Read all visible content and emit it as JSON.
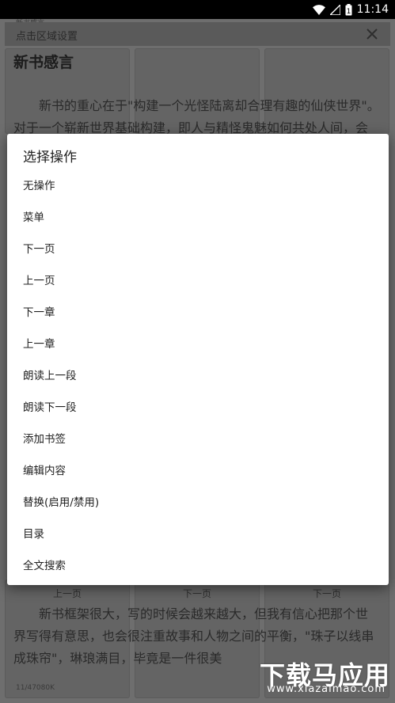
{
  "status_bar": {
    "time": "11:14",
    "battery_level": "1"
  },
  "page": {
    "header_label": "新书感言",
    "topbar_title": "点击区域设置",
    "title": "新书感言",
    "para_top_1": "　　新书的重心在于\"构建一个光怪陆离却合理有趣的仙侠世界\"。",
    "para_top_2": "对于一个崭新世界基础构建，即人与精怪鬼魅如何共处人间，会",
    "cell_bottom_labels": [
      "上一页",
      "下一页",
      "下一页"
    ],
    "para_bottom_1": "　　新书框架很大，写的时候会越来越大，但我有信心把那个世",
    "para_bottom_2": "界写得有意思，也会很注重故事和人物之间的平衡，\"珠子以线串",
    "para_bottom_3": "成珠帘\"，琳琅满目，毕竟是一件很美",
    "footer_label": "11/47080K"
  },
  "watermark": {
    "title": "下载马应用",
    "subtitle": "www.xiazaimao.com"
  },
  "dialog": {
    "title": "选择操作",
    "options": [
      "无操作",
      "菜单",
      "下一页",
      "上一页",
      "下一章",
      "上一章",
      "朗读上一段",
      "朗读下一段",
      "添加书签",
      "编辑内容",
      "替换(启用/禁用)",
      "目录",
      "全文搜索"
    ]
  },
  "colors": {
    "dialog_bg": "#ffffff",
    "scrim": "#6e6e6e",
    "status_bar": "#000000"
  }
}
